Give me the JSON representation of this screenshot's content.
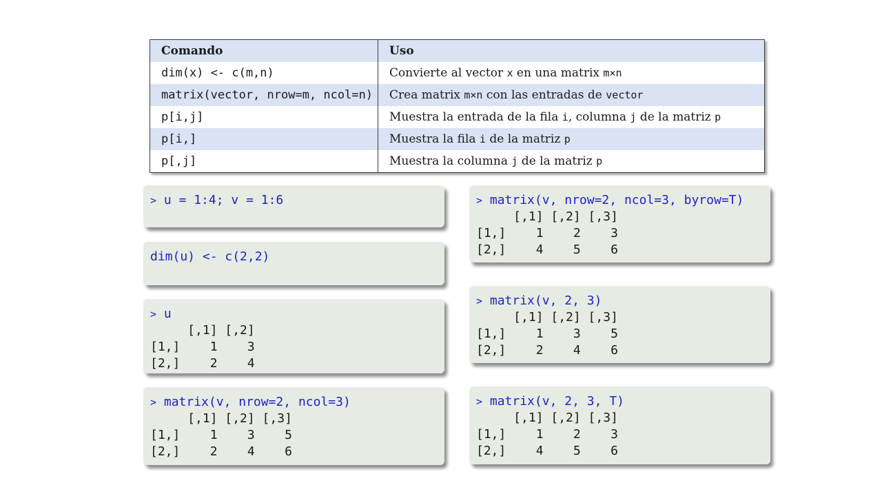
{
  "table": {
    "headers": [
      "Comando",
      "Uso"
    ],
    "rows": [
      {
        "cmd": "dim(x) <- c(m,n)",
        "use": [
          {
            "t": "Convierte al vector "
          },
          {
            "m": "x"
          },
          {
            "t": " en una matrix "
          },
          {
            "m": "m×n"
          }
        ]
      },
      {
        "cmd": "matrix(vector, nrow=m, ncol=n)",
        "use": [
          {
            "t": "Crea matrix "
          },
          {
            "m": "m×n"
          },
          {
            "t": " con las entradas de "
          },
          {
            "m": "vector"
          }
        ]
      },
      {
        "cmd": "p[i,j]",
        "use": [
          {
            "t": "Muestra la entrada de la fila "
          },
          {
            "m": "i"
          },
          {
            "t": ", columna "
          },
          {
            "m": "j"
          },
          {
            "t": " de la matriz "
          },
          {
            "m": "p"
          }
        ]
      },
      {
        "cmd": "p[i,]",
        "use": [
          {
            "t": "Muestra la fila "
          },
          {
            "m": "i"
          },
          {
            "t": " de la matriz "
          },
          {
            "m": "p"
          }
        ]
      },
      {
        "cmd": "p[,j]",
        "use": [
          {
            "t": "Muestra la columna "
          },
          {
            "m": "j"
          },
          {
            "t": " de la matriz "
          },
          {
            "m": "p"
          }
        ]
      }
    ]
  },
  "prompt_symbol": ">",
  "left_boxes": [
    {
      "prompt": true,
      "input": "u = 1:4; v = 1:6",
      "output": []
    },
    {
      "prompt": false,
      "input": "dim(u) <- c(2,2)",
      "output": []
    },
    {
      "prompt": true,
      "input": "u",
      "output": [
        "     [,1] [,2]",
        "[1,]    1    3",
        "[2,]    2    4"
      ]
    },
    {
      "prompt": true,
      "input": "matrix(v, nrow=2, ncol=3)",
      "output": [
        "     [,1] [,2] [,3]",
        "[1,]    1    3    5",
        "[2,]    2    4    6"
      ]
    }
  ],
  "right_boxes": [
    {
      "prompt": true,
      "input": "matrix(v, nrow=2, ncol=3, byrow=T)",
      "output": [
        "     [,1] [,2] [,3]",
        "[1,]    1    2    3",
        "[2,]    4    5    6"
      ]
    },
    {
      "prompt": true,
      "input": "matrix(v, 2, 3)",
      "output": [
        "     [,1] [,2] [,3]",
        "[1,]    1    3    5",
        "[2,]    2    4    6"
      ]
    },
    {
      "prompt": true,
      "input": "matrix(v, 2, 3, T)",
      "output": [
        "     [,1] [,2] [,3]",
        "[1,]    1    2    3",
        "[2,]    4    5    6"
      ]
    }
  ],
  "colors": {
    "input": "#1f22c9",
    "code_bg": "#e6ece4",
    "header_bg": "#d9e3f3"
  }
}
